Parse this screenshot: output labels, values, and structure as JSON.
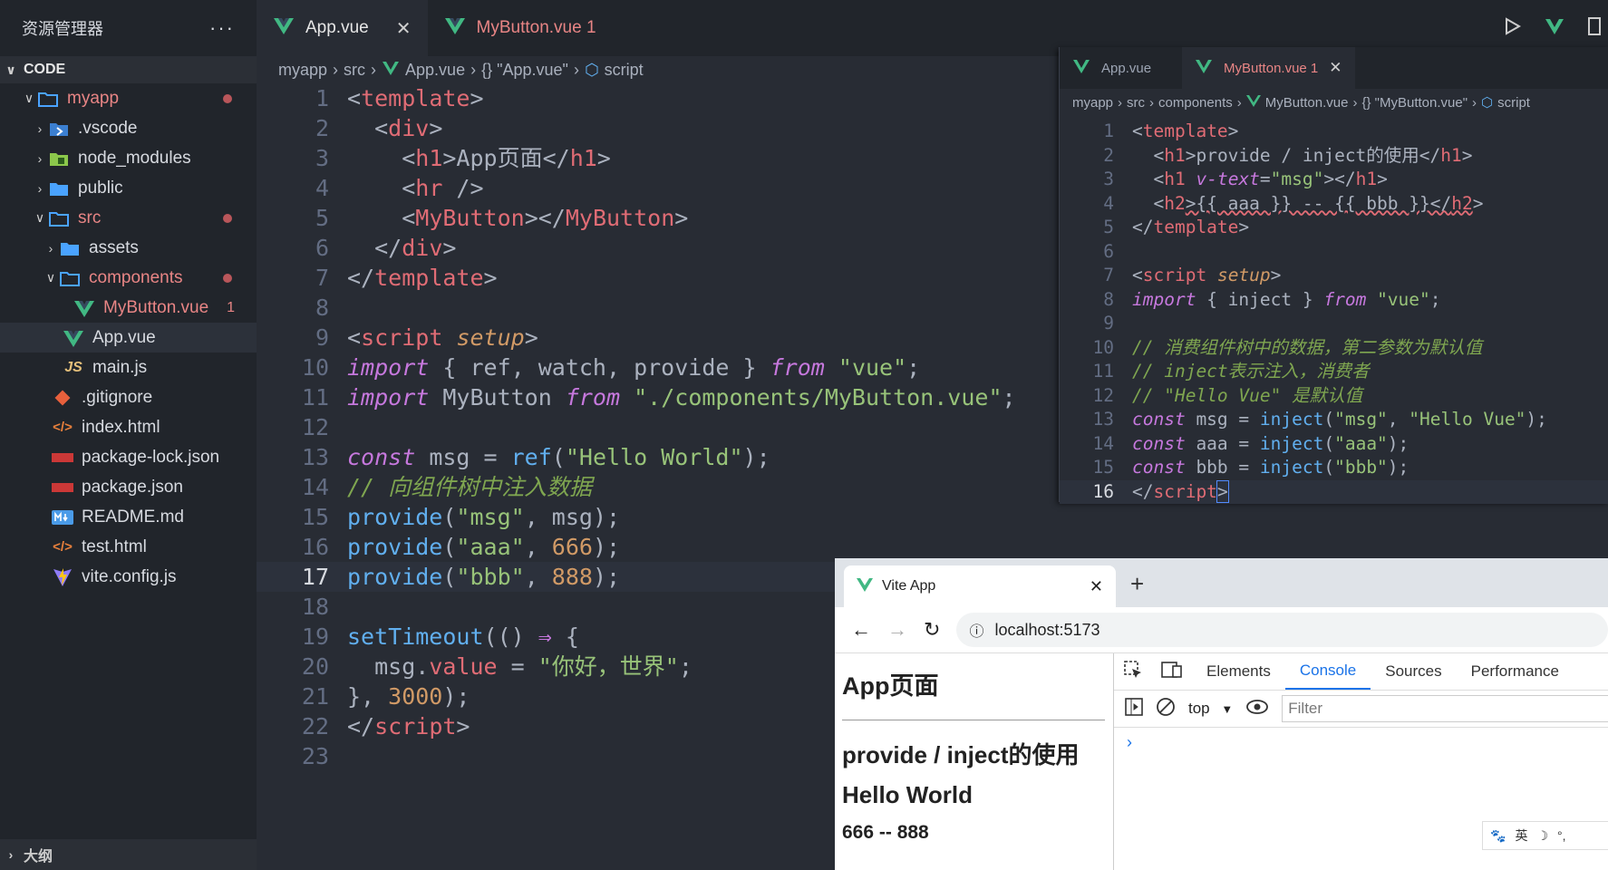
{
  "sidebar": {
    "title": "资源管理器",
    "section": "CODE",
    "outline": "大纲",
    "items": [
      {
        "label": "myapp"
      },
      {
        "label": ".vscode"
      },
      {
        "label": "node_modules"
      },
      {
        "label": "public"
      },
      {
        "label": "src"
      },
      {
        "label": "assets"
      },
      {
        "label": "components"
      },
      {
        "label": "MyButton.vue",
        "badge": "1"
      },
      {
        "label": "App.vue"
      },
      {
        "label": "main.js"
      },
      {
        "label": ".gitignore"
      },
      {
        "label": "index.html"
      },
      {
        "label": "package-lock.json"
      },
      {
        "label": "package.json"
      },
      {
        "label": "README.md"
      },
      {
        "label": "test.html"
      },
      {
        "label": "vite.config.js"
      }
    ]
  },
  "editor": {
    "tabs": [
      {
        "label": "App.vue"
      },
      {
        "label": "MyButton.vue 1"
      }
    ],
    "breadcrumb": [
      "myapp",
      "src",
      "App.vue",
      "{} \"App.vue\"",
      "script"
    ],
    "line_numbers": [
      "1",
      "2",
      "3",
      "4",
      "5",
      "6",
      "7",
      "8",
      "9",
      "10",
      "11",
      "12",
      "13",
      "14",
      "15",
      "16",
      "17",
      "18",
      "19",
      "20",
      "21",
      "22",
      "23"
    ]
  },
  "mini": {
    "tabs": [
      {
        "label": "App.vue"
      },
      {
        "label": "MyButton.vue 1"
      }
    ],
    "breadcrumb": [
      "myapp",
      "src",
      "components",
      "MyButton.vue",
      "{} \"MyButton.vue\"",
      "script"
    ],
    "line_numbers": [
      "1",
      "2",
      "3",
      "4",
      "5",
      "6",
      "7",
      "8",
      "9",
      "10",
      "11",
      "12",
      "13",
      "14",
      "15",
      "16"
    ]
  },
  "browser": {
    "tab_title": "Vite App",
    "url": "localhost:5173",
    "page": {
      "h1": "App页面",
      "h1b": "provide / inject的使用",
      "msg": "Hello World",
      "h2": "666 -- 888"
    },
    "devtools": {
      "tabs": [
        "Elements",
        "Console",
        "Sources",
        "Performance"
      ],
      "context": "top",
      "filter_placeholder": "Filter"
    },
    "ime": "英"
  },
  "colors": {
    "keyword": "#c678dd",
    "tag": "#e06c75",
    "string": "#98c379",
    "function": "#61afef",
    "number": "#d19a66",
    "comment": "#7fa650"
  }
}
